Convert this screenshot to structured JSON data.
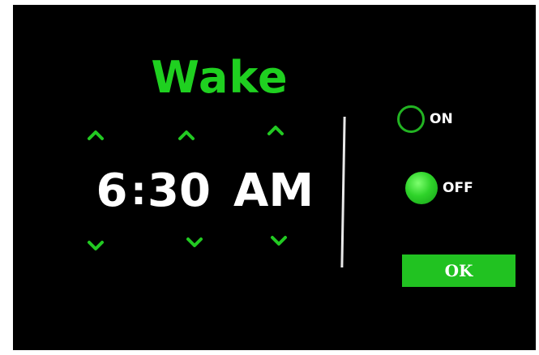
{
  "screen": {
    "title": "Wake",
    "time": {
      "hour": "6",
      "separator": ":",
      "minute": "30",
      "period": "AM"
    },
    "arrows": {
      "up_icon": "chevron-up-icon",
      "down_icon": "chevron-down-icon"
    },
    "radio": {
      "on_label": "ON",
      "off_label": "OFF",
      "selected": "OFF"
    },
    "ok_label": "OK",
    "colors": {
      "accent": "#1fd020",
      "background": "#000000",
      "text": "#ffffff"
    }
  }
}
